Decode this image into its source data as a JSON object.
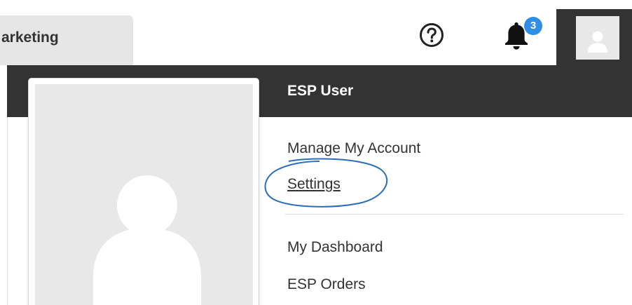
{
  "header": {
    "tab_label": "arketing",
    "notification_count": "3",
    "help_icon": "question-circle-icon",
    "notification_icon": "bell-icon",
    "avatar_icon": "user-silhouette-icon"
  },
  "user_menu": {
    "user_name": "ESP User",
    "items": [
      {
        "label": "Manage My Account"
      },
      {
        "label": "Settings"
      },
      {
        "label": "My Dashboard"
      },
      {
        "label": "ESP Orders"
      }
    ]
  },
  "colors": {
    "dark_band": "#333333",
    "badge": "#2f8fe6",
    "annotation": "#2a6fb5",
    "placeholder": "#e8e8e8"
  }
}
